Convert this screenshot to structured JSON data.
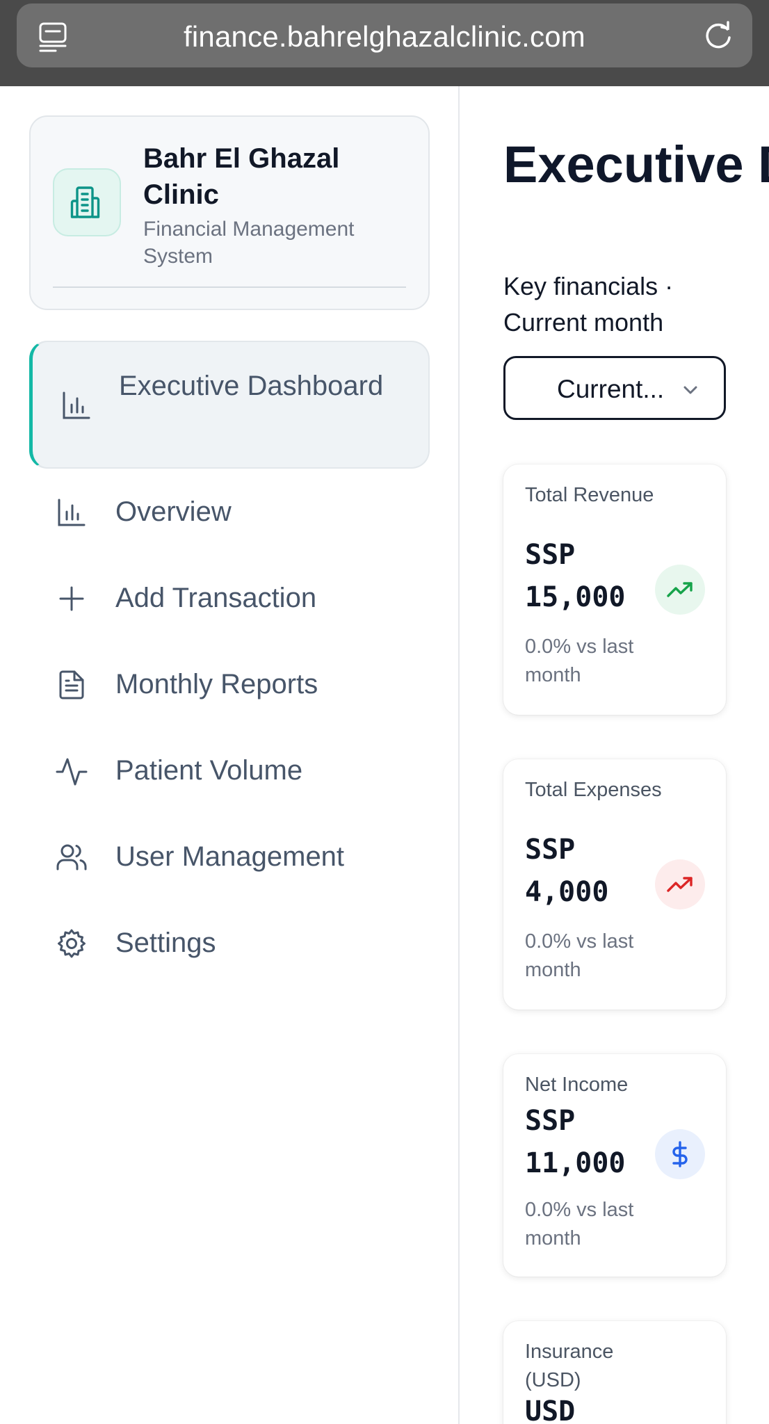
{
  "browser": {
    "url": "finance.bahrelghazalclinic.com",
    "tabs_icon": "tabs-icon",
    "reload_icon": "reload-icon"
  },
  "sidebar": {
    "brand": {
      "title": "Bahr El Ghazal Clinic",
      "subtitle": "Financial Management System",
      "icon": "building-icon",
      "accent": "#14b8a6"
    },
    "items": [
      {
        "label": "Executive Dashboard",
        "icon": "bar-chart-icon",
        "active": true
      },
      {
        "label": "Overview",
        "icon": "bar-chart-icon"
      },
      {
        "label": "Add Transaction",
        "icon": "plus-icon"
      },
      {
        "label": "Monthly Reports",
        "icon": "document-icon"
      },
      {
        "label": "Patient Volume",
        "icon": "activity-icon"
      },
      {
        "label": "User Management",
        "icon": "users-icon"
      },
      {
        "label": "Settings",
        "icon": "gear-icon"
      }
    ]
  },
  "main": {
    "title": "Executive Dashboard",
    "subtitle": "Key financials · Current month",
    "period_select": {
      "value": "Current..."
    },
    "cards": [
      {
        "label": "Total Revenue",
        "value": "SSP 15,000",
        "change": "0.0% vs last month",
        "icon": "trending-up-icon",
        "color": "#16a34a"
      },
      {
        "label": "Total Expenses",
        "value": "SSP 4,000",
        "change": "0.0% vs last month",
        "icon": "trending-up-icon",
        "color": "#dc2626"
      },
      {
        "label": "Net Income",
        "value": "SSP 11,000",
        "change": "0.0% vs last month",
        "icon": "dollar-icon",
        "color": "#2563eb"
      },
      {
        "label": "Insurance (USD)",
        "value": "USD"
      }
    ]
  }
}
